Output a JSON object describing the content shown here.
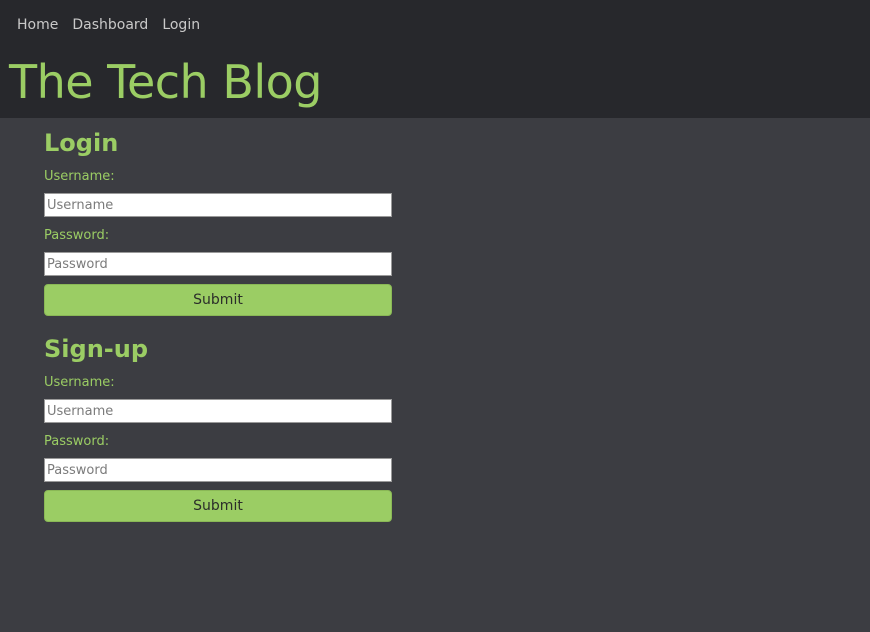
{
  "nav": {
    "items": [
      {
        "label": "Home"
      },
      {
        "label": "Dashboard"
      },
      {
        "label": "Login"
      }
    ]
  },
  "site": {
    "title": "The Tech Blog"
  },
  "login": {
    "heading": "Login",
    "username_label": "Username:",
    "username_placeholder": "Username",
    "password_label": "Password:",
    "password_placeholder": "Password",
    "submit_label": "Submit"
  },
  "signup": {
    "heading": "Sign-up",
    "username_label": "Username:",
    "username_placeholder": "Username",
    "password_label": "Password:",
    "password_placeholder": "Password",
    "submit_label": "Submit"
  },
  "colors": {
    "accent": "#9bcd64",
    "header_bg": "#27282c",
    "page_bg": "#3c3d42"
  }
}
